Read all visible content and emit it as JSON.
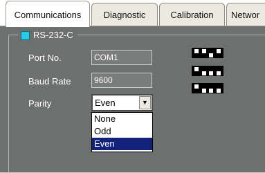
{
  "tabs": [
    {
      "label": "Communications"
    },
    {
      "label": "Diagnostic"
    },
    {
      "label": "Calibration"
    },
    {
      "label": "Networ"
    }
  ],
  "group": {
    "title": "RS-232-C"
  },
  "fields": {
    "port_no": {
      "label": "Port No.",
      "value": "COM1"
    },
    "baud_rate": {
      "label": "Baud Rate",
      "value": "9600"
    },
    "parity": {
      "label": "Parity",
      "value": "Even"
    }
  },
  "parity_options": [
    "None",
    "Odd",
    "Even"
  ],
  "colors": {
    "panel": "#6e6f6f",
    "legend_marker": "#27c9e6",
    "selection": "#12227a"
  },
  "icons": {
    "dip_switches": [
      "dip-switch-icon",
      "dip-switch-icon",
      "dip-switch-icon"
    ],
    "dropdown": "chevron-down-icon"
  }
}
